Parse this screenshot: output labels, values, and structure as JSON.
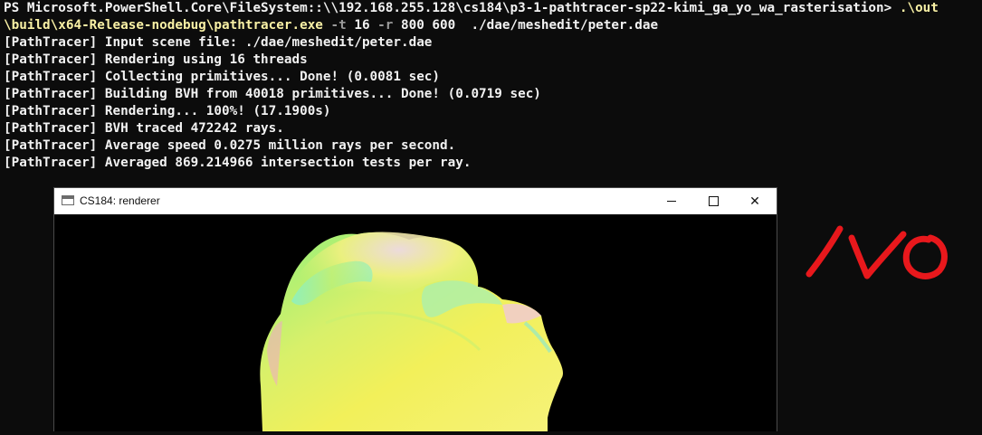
{
  "terminal": {
    "lines": [
      {
        "parts": [
          {
            "t": "PS Microsoft.PowerShell.Core\\FileSystem::\\\\192.168.255.128\\cs184\\p3-1-pathtracer-sp22-kimi_ga_yo_wa_rasterisation> ",
            "c": "w"
          },
          {
            "t": ".\\out",
            "c": "y"
          }
        ]
      },
      {
        "parts": [
          {
            "t": "\\build\\x64-Release-nodebug\\pathtracer.exe",
            "c": "y"
          },
          {
            "t": " -t ",
            "c": "g"
          },
          {
            "t": "16",
            "c": "w"
          },
          {
            "t": " -r ",
            "c": "g"
          },
          {
            "t": "800 600  ./dae/meshedit/peter.dae",
            "c": "w"
          }
        ]
      },
      {
        "parts": [
          {
            "t": "[PathTracer] Input scene file: ./dae/meshedit/peter.dae",
            "c": "w"
          }
        ]
      },
      {
        "parts": [
          {
            "t": "[PathTracer] Rendering using 16 threads",
            "c": "w"
          }
        ]
      },
      {
        "parts": [
          {
            "t": "[PathTracer] Collecting primitives... Done! (0.0081 sec)",
            "c": "w"
          }
        ]
      },
      {
        "parts": [
          {
            "t": "[PathTracer] Building BVH from 40018 primitives... Done! (0.0719 sec)",
            "c": "w"
          }
        ]
      },
      {
        "parts": [
          {
            "t": "[PathTracer] Rendering... 100%! (17.1900s)",
            "c": "w"
          }
        ]
      },
      {
        "parts": [
          {
            "t": "[PathTracer] BVH traced 472242 rays.",
            "c": "w"
          }
        ]
      },
      {
        "parts": [
          {
            "t": "[PathTracer] Average speed 0.0275 million rays per second.",
            "c": "w"
          }
        ]
      },
      {
        "parts": [
          {
            "t": "[PathTracer] Averaged 869.214966 intersection tests per ray.",
            "c": "w"
          }
        ]
      }
    ]
  },
  "window": {
    "title": "CS184: renderer",
    "app_icon": "window-app-icon",
    "controls": [
      "minimize-icon",
      "maximize-icon",
      "close-icon"
    ],
    "close_glyph": "✕"
  },
  "render": {
    "subject": "normal-shaded head mesh (peter.dae)",
    "colors": {
      "yellow": "#f2f05a",
      "green": "#8ff07a",
      "cyan": "#7ff0d8",
      "pink": "#f0a0c8",
      "background": "#000000"
    }
  },
  "annotation": {
    "color": "#e8181c"
  },
  "colors": {
    "terminal_bg": "#0c0c0c",
    "terminal_fg": "#f2f2f2",
    "command_yellow": "#f9f1a5",
    "param_gray": "#9a9a9a"
  }
}
